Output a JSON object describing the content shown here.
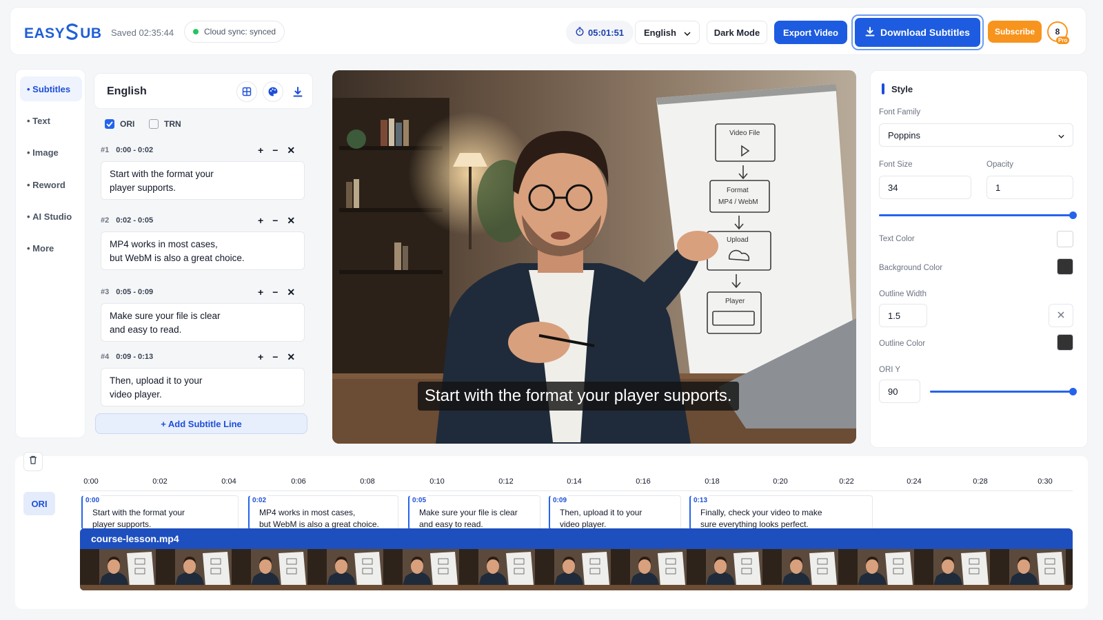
{
  "header": {
    "logo_pre": "EASY",
    "logo_post": "UB",
    "saved": "Saved 02:35:44",
    "sync": "Cloud sync: synced",
    "timer": "05:01:51",
    "language": "English",
    "dark_mode": "Dark Mode",
    "export": "Export Video",
    "download": "Download Subtitles",
    "subscribe": "Subscribe",
    "avatar": "8",
    "badge": "Pro"
  },
  "nav": {
    "items": [
      {
        "label": "Subtitles"
      },
      {
        "label": "Text"
      },
      {
        "label": "Image"
      },
      {
        "label": "Reword"
      },
      {
        "label": "AI Studio"
      },
      {
        "label": "More"
      }
    ]
  },
  "subtitles": {
    "language": "English",
    "ori_label": "ORI",
    "trn_label": "TRN",
    "entries": [
      {
        "num": "#1",
        "time": "0:00 - 0:02",
        "line1": "Start with the format your",
        "line2": "player supports."
      },
      {
        "num": "#2",
        "time": "0:02 - 0:05",
        "line1": "MP4 works in most cases,",
        "line2": "but WebM is also a great choice."
      },
      {
        "num": "#3",
        "time": "0:05 - 0:09",
        "line1": "Make sure your file is clear",
        "line2": "and easy to read."
      },
      {
        "num": "#4",
        "time": "0:09 - 0:13",
        "line1": "Then, upload it to your",
        "line2": "video player."
      }
    ],
    "add_line": "+ Add Subtitle Line",
    "tool_plus": "+",
    "tool_minus": "−",
    "tool_close": "✕"
  },
  "video": {
    "caption": "Start with the format your player supports.",
    "whiteboard": {
      "box1": "Video File",
      "box2a": "Format",
      "box2b": "MP4 / WebM",
      "box3": "Upload",
      "box4": "Player"
    }
  },
  "style": {
    "title": "Style",
    "font_family_label": "Font Family",
    "font_family": "Poppins",
    "font_size_label": "Font Size",
    "font_size": "34",
    "opacity_label": "Opacity",
    "opacity": "1",
    "opacity_level": 1.0,
    "text_color_label": "Text Color",
    "text_color": "#ffffff",
    "bg_color_label": "Background Color",
    "bg_color": "#333333",
    "outline_width_label": "Outline Width",
    "outline_width": "1.5",
    "outline_color_label": "Outline Color",
    "outline_color": "#333333",
    "ori_y_label": "ORI Y",
    "ori_y": "90",
    "ori_y_level": 1.0
  },
  "timeline": {
    "ticks": [
      "0:00",
      "0:02",
      "0:04",
      "0:06",
      "0:08",
      "0:10",
      "0:12",
      "0:14",
      "0:16",
      "0:18",
      "0:20",
      "0:22",
      "0:24",
      "0:28",
      "0:30"
    ],
    "track_label": "ORI",
    "segments": [
      {
        "time": "0:00",
        "line1": "Start with the format your",
        "line2": "player supports."
      },
      {
        "time": "0:02",
        "line1": "MP4 works in most cases,",
        "line2": "but WebM is also a great choice."
      },
      {
        "time": "0:05",
        "line1": "Make sure your file is clear",
        "line2": "and easy to read."
      },
      {
        "time": "0:09",
        "line1": "Then, upload it to your",
        "line2": "video player."
      },
      {
        "time": "0:13",
        "line1": "Finally, check your video to make",
        "line2": "sure everything looks perfect."
      }
    ],
    "clip_name": "course-lesson.mp4"
  },
  "colors": {
    "accent": "#1d5ce0",
    "subscribe": "#f7941d",
    "sync_dot": "#22c55e"
  }
}
